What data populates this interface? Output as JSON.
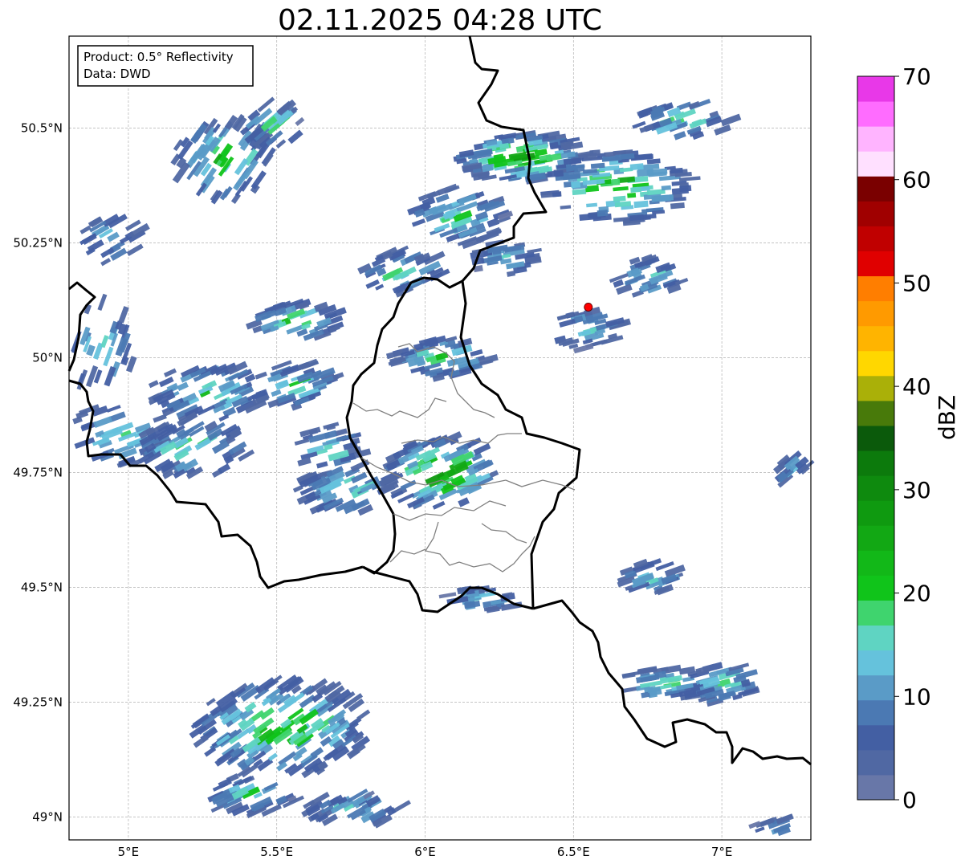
{
  "title": "02.11.2025 04:28 UTC",
  "info_box": {
    "product": "Product: 0.5° Reflectivity",
    "source": "Data: DWD"
  },
  "axes": {
    "lon_ticks": [
      "5°E",
      "5.5°E",
      "6°E",
      "6.5°E",
      "7°E"
    ],
    "lat_ticks": [
      "50.5°N",
      "50.25°N",
      "50°N",
      "49.75°N",
      "49.5°N",
      "49.25°N",
      "49°N"
    ],
    "lon_range": [
      4.8,
      7.3
    ],
    "lat_range": [
      48.95,
      50.7
    ],
    "grid": true
  },
  "colorbar": {
    "unit": "dBZ",
    "tick_labels": [
      "0",
      "10",
      "20",
      "30",
      "40",
      "50",
      "60",
      "70"
    ],
    "range": [
      0,
      70
    ],
    "step": 2.5,
    "colors": [
      "#6877a8",
      "#5068a3",
      "#435fa3",
      "#4b79b3",
      "#5a9bc7",
      "#65c2dc",
      "#5fd4c2",
      "#3fd46e",
      "#10c41a",
      "#12b818",
      "#12a814",
      "#0f9a10",
      "#0e8a0e",
      "#0c7a0c",
      "#0b5a0b",
      "#487a0a",
      "#aab008",
      "#ffd700",
      "#ffb400",
      "#ff9a00",
      "#ff7e00",
      "#e00000",
      "#c00000",
      "#a00000",
      "#7a0000",
      "#ffe0ff",
      "#ffb4ff",
      "#ff6cff",
      "#e838e8"
    ]
  },
  "radar_site": {
    "lon": 6.55,
    "lat": 50.11,
    "color": "#ff0000"
  },
  "colors": {
    "border": "#000000",
    "admin_border": "#808080",
    "grid": "#b0b0b0"
  }
}
